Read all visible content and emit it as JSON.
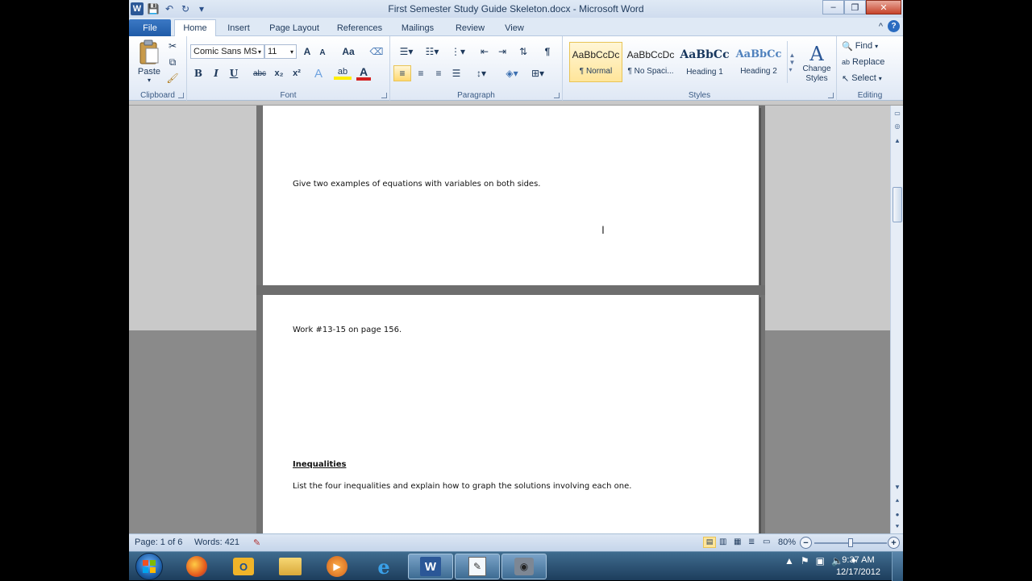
{
  "window": {
    "title": "First Semester Study Guide Skeleton.docx - Microsoft Word",
    "minimize_glyph": "–",
    "restore_glyph": "❐",
    "close_glyph": "✕"
  },
  "quick_access": {
    "app_letter": "W",
    "save_glyph": "💾",
    "undo_glyph": "↶",
    "redo_glyph": "↻",
    "customize_glyph": "▾"
  },
  "tabs": {
    "file": "File",
    "home": "Home",
    "insert": "Insert",
    "page_layout": "Page Layout",
    "references": "References",
    "mailings": "Mailings",
    "review": "Review",
    "view": "View",
    "collapse_glyph": "^",
    "help_glyph": "?"
  },
  "ribbon": {
    "clipboard": {
      "label": "Clipboard",
      "paste": "Paste"
    },
    "font": {
      "label": "Font",
      "font_name": "Comic Sans MS",
      "font_size": "11",
      "grow_glyph": "A",
      "shrink_glyph": "A",
      "case_glyph": "Aa",
      "bold": "B",
      "italic": "I",
      "underline": "U",
      "strike": "abc",
      "subscript": "x₂",
      "superscript": "x²",
      "text_effect": "A",
      "highlight": "ab",
      "font_color": "A"
    },
    "paragraph": {
      "label": "Paragraph",
      "show_marks": "¶"
    },
    "styles": {
      "label": "Styles",
      "items": [
        {
          "sample": "AaBbCcDc",
          "name": "¶ Normal"
        },
        {
          "sample": "AaBbCcDc",
          "name": "¶ No Spaci..."
        },
        {
          "sample": "AaBbCc",
          "name": "Heading 1"
        },
        {
          "sample": "AaBbCc",
          "name": "Heading 2"
        }
      ],
      "change_styles_line1": "Change",
      "change_styles_line2": "Styles"
    },
    "editing": {
      "label": "Editing",
      "find": "Find",
      "replace": "Replace",
      "select": "Select"
    }
  },
  "document": {
    "page1_text": "Give two examples of equations with variables on both sides.",
    "page2_text": "Work #13-15 on page 156.",
    "heading": "Inequalities",
    "page2_text2": "List the four inequalities and explain how to graph the solutions involving each one."
  },
  "status": {
    "page": "Page: 1 of 6",
    "words": "Words: 421",
    "zoom": "80%",
    "zoom_out": "−",
    "zoom_in": "+",
    "zoom_level": 0.5
  },
  "taskbar": {
    "word_letter": "W",
    "time": "9:37 AM",
    "date": "12/17/2012"
  },
  "colors": {
    "ribbon_bg": "#dfe8f5",
    "file_tab": "#1f5ba8",
    "selected_style": "#ffe59a",
    "taskbar": "#1d3d5c"
  }
}
